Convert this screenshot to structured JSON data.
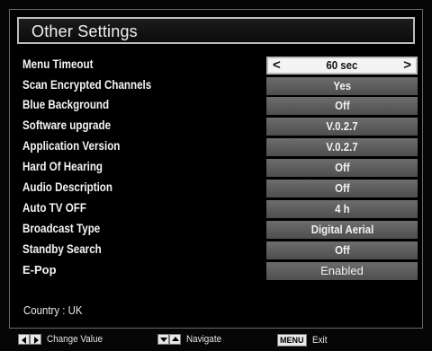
{
  "menu": {
    "title": "Other Settings",
    "rows": [
      {
        "label": "Menu Timeout",
        "value": "60 sec"
      },
      {
        "label": "Scan Encrypted Channels",
        "value": "Yes"
      },
      {
        "label": "Blue Background",
        "value": "Off"
      },
      {
        "label": "Software upgrade",
        "value": "V.0.2.7"
      },
      {
        "label": "Application Version",
        "value": "V.0.2.7"
      },
      {
        "label": "Hard Of Hearing",
        "value": "Off"
      },
      {
        "label": "Audio Description",
        "value": "Off"
      },
      {
        "label": "Auto TV OFF",
        "value": "4 h"
      },
      {
        "label": "Broadcast Type",
        "value": "Digital Aerial"
      },
      {
        "label": "Standby Search",
        "value": "Off"
      },
      {
        "label": "E-Pop",
        "value": "Enabled"
      }
    ],
    "selected_arrows": {
      "left": "<",
      "right": ">"
    },
    "country": "Country : UK"
  },
  "footer": {
    "change_value": "Change Value",
    "navigate": "Navigate",
    "menu_key": "MENU",
    "exit": "Exit"
  },
  "colors": {
    "background": "#000000",
    "value_bar": "#5e5e5e",
    "selected_bar": "#f4f4f4",
    "text": "#f2f2f2"
  }
}
